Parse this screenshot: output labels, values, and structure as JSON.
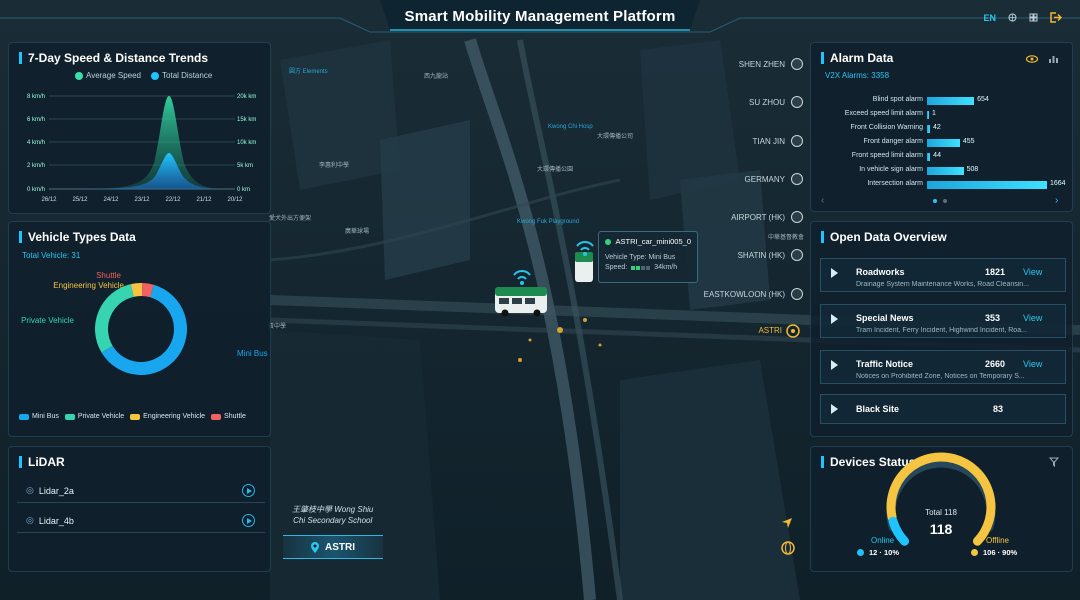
{
  "header": {
    "title": "Smart Mobility Management Platform",
    "lang": "EN"
  },
  "speed_chart": {
    "title": "7-Day Speed & Distance Trends",
    "legend": [
      "Average Speed",
      "Total Distance"
    ],
    "y_left_ticks": [
      "8 km/h",
      "6 km/h",
      "4 km/h",
      "2 km/h",
      "0 km/h"
    ],
    "y_right_ticks": [
      "20k km",
      "15k km",
      "10k km",
      "5k km",
      "0 km"
    ],
    "x_ticks": [
      "26/12",
      "25/12",
      "24/12",
      "23/12",
      "22/12",
      "21/12",
      "20/12"
    ]
  },
  "vehicle_types": {
    "title": "Vehicle Types Data",
    "total_label": "Total Vehicle: 31",
    "slices": [
      {
        "name": "Mini Bus",
        "color": "#18a7ee",
        "value": 62
      },
      {
        "name": "Private Vehicle",
        "color": "#36d4b0",
        "value": 30
      },
      {
        "name": "Engineering Vehicle",
        "color": "#f5c542",
        "value": 4
      },
      {
        "name": "Shuttle",
        "color": "#f26161",
        "value": 4
      }
    ]
  },
  "lidar": {
    "title": "LiDAR",
    "items": [
      {
        "label": "Lidar_2a"
      },
      {
        "label": "Lidar_4b"
      }
    ]
  },
  "alarm": {
    "title": "Alarm Data",
    "v2x_label": "V2X Alarms: 3358",
    "rows": [
      {
        "label": "Blind spot alarm",
        "value": 654
      },
      {
        "label": "Exceed speed limit alarm",
        "value": 1
      },
      {
        "label": "Front Collision Warning",
        "value": 42
      },
      {
        "label": "Front danger alarm",
        "value": 455
      },
      {
        "label": "Front speed limit alarm",
        "value": 44
      },
      {
        "label": "In vehicle sign alarm",
        "value": 508
      },
      {
        "label": "Intersection alarm",
        "value": 1664
      }
    ]
  },
  "open_data": {
    "title": "Open Data Overview",
    "items": [
      {
        "name": "Roadworks",
        "count": "1821",
        "view": "View",
        "desc": "Drainage System Maintenance Works, Road Cleansin..."
      },
      {
        "name": "Special News",
        "count": "353",
        "view": "View",
        "desc": "Tram Incident, Ferry Incident, Highwind Incident, Roa..."
      },
      {
        "name": "Traffic Notice",
        "count": "2660",
        "view": "View",
        "desc": "Notices on Prohibited Zone, Notices on Temporary S..."
      },
      {
        "name": "Black Site",
        "count": "83",
        "view": "",
        "desc": ""
      }
    ]
  },
  "devices": {
    "title": "Devices Status",
    "total_label": "Total 118",
    "total_value": "118",
    "online": {
      "label": "Online",
      "value": "12 · 10%",
      "fraction": 0.1
    },
    "offline": {
      "label": "Offline",
      "value": "106 · 90%",
      "fraction": 0.9
    }
  },
  "map": {
    "cities": [
      "SHEN ZHEN",
      "SU ZHOU",
      "TIAN JIN",
      "GERMANY",
      "AIRPORT (HK)",
      "SHATIN (HK)",
      "EASTKOWLOON (HK)",
      "ASTRI"
    ],
    "vehicle_popup": {
      "name": "ASTRI_car_mini005_0",
      "type": "Vehicle Type: Mini Bus",
      "speed_label": "Speed:",
      "speed_value": "34km/h"
    },
    "location_button": "ASTRI",
    "school_label_cn": "王肇枝中學",
    "school_label_en": "Wong Shiu",
    "school_label_en2": "Chi Secondary School"
  },
  "colors": {
    "accent": "#1ec3ff",
    "alarm_icon": "#f5c542"
  }
}
